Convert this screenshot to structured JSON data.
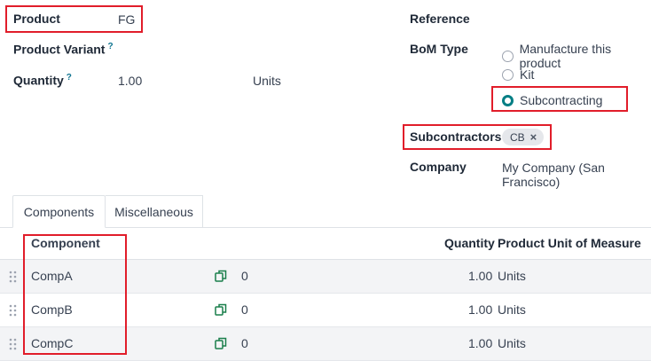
{
  "form": {
    "product_label": "Product",
    "product_value": "FG",
    "variant_label": "Product Variant",
    "help_mark": "?",
    "quantity_label": "Quantity",
    "quantity_value": "1.00",
    "quantity_uom": "Units",
    "reference_label": "Reference",
    "bom_type_label": "BoM Type",
    "bom_type_options": [
      "Manufacture this product",
      "Kit",
      "Subcontracting"
    ],
    "bom_type_selected": "Subcontracting",
    "subcontractors_label": "Subcontractors",
    "subcontractor_tag": "CB",
    "tag_remove": "×",
    "company_label": "Company",
    "company_value": "My Company (San Francisco)"
  },
  "tabs": [
    "Components",
    "Miscellaneous"
  ],
  "table": {
    "headers": {
      "component": "Component",
      "quantity": "Quantity",
      "uom": "Product Unit of Measure"
    },
    "rows": [
      {
        "component": "CompA",
        "avail": "0",
        "quantity": "1.00",
        "uom": "Units"
      },
      {
        "component": "CompB",
        "avail": "0",
        "quantity": "1.00",
        "uom": "Units"
      },
      {
        "component": "CompC",
        "avail": "0",
        "quantity": "1.00",
        "uom": "Units"
      }
    ]
  },
  "colors": {
    "highlight": "#e11d2a",
    "accent": "#017e84",
    "help": "#0e7490"
  },
  "icons": {
    "row_handle": "drag-handle-icon",
    "availability": "duplicate-icon",
    "tag_remove": "close-icon"
  }
}
